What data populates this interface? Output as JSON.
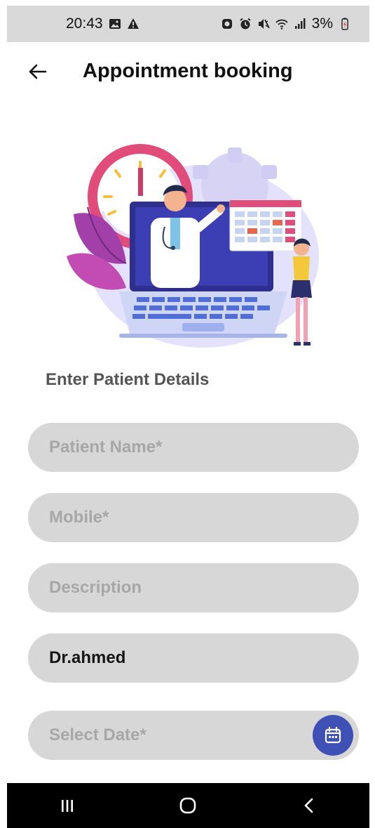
{
  "status_bar": {
    "time": "20:43",
    "battery": "3%",
    "icons": [
      "image-icon",
      "warning-icon",
      "recorder-icon",
      "alarm-icon",
      "mute-icon",
      "wifi-icon",
      "signal-icon",
      "battery-charging-icon"
    ]
  },
  "header": {
    "title": "Appointment booking",
    "back_icon": "arrow-left-icon"
  },
  "hero": {
    "icon": "doctor-video-consultation-illustration"
  },
  "form": {
    "heading": "Enter Patient Details",
    "patient_name_placeholder": "Patient Name*",
    "mobile_placeholder": "Mobile*",
    "description_placeholder": "Description",
    "doctor_value": "Dr.ahmed",
    "date_placeholder": "Select Date*",
    "calendar_icon": "calendar-icon"
  },
  "nav_bar": {
    "buttons": [
      "recent-apps-icon",
      "home-icon",
      "back-icon"
    ]
  },
  "colors": {
    "accent": "#3f51b5",
    "field_background": "#d7d7d7",
    "placeholder": "#a7a7a7"
  }
}
